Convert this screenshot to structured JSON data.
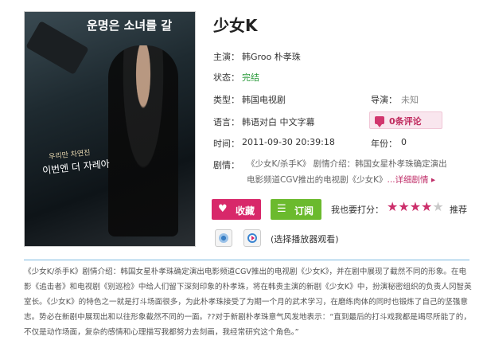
{
  "poster": {
    "banner_text": "운명은 소녀를 갈",
    "subtitle_small": "우리만 차연진",
    "subtitle_large": "이번엔 더 자레아"
  },
  "title": "少女K",
  "fields": {
    "lead_label": "主演：",
    "lead_value": "韩Groo 朴孝珠",
    "status_label": "状态：",
    "status_value": "完结",
    "type_label": "类型：",
    "type_value": "韩国电视剧",
    "director_label": "导演：",
    "director_value": "未知",
    "language_label": "语言：",
    "language_value": "韩语对白 中文字幕",
    "comments_value": "0条评论",
    "time_label": "时间：",
    "time_value": "2011-09-30 20:39:18",
    "year_label": "年份：",
    "year_value": "0",
    "plot_label": "剧情：",
    "plot_value": "《少女K/杀手K》 剧情介绍：韩国女星朴孝珠确定演出电影频道CGV推出的电视剧《少女K》",
    "plot_more": "...详细剧情 ▸"
  },
  "actions": {
    "favorite_label": "收藏",
    "subscribe_label": "订阅",
    "rate_label": "我也要打分：",
    "rating": 4,
    "rating_max": 5,
    "recommend_label": "推荐",
    "select_player_label": "(选择播放器观看)"
  },
  "description": "《少女K/杀手K》剧情介绍：韩国女星朴孝珠确定演出电影频道CGV推出的电视剧《少女K》，并在剧中展现了截然不同的形象。在电影《追击者》和电视剧《别巡检》中给人们留下深刻印象的朴孝珠，将在韩贵主演的新剧《少女K》中，扮演秘密组织的负责人冈智英室长。《少女K》的特色之一就是打斗场面很多，为此朴孝珠接受了为期一个月的武术学习，在磨练肉体的同时也锻炼了自己的坚强意志。势必在新剧中展现出和以往形象截然不同的一面。??对于新剧朴孝珠意气风发地表示：“直到最后的打斗戏我都是竭尽所能了的，不仅是动作场面，复杂的感情和心理描写我都努力去刻画，我经常研究这个角色。”",
  "colors": {
    "accent_pink": "#d8286a",
    "accent_green": "#6bba2e",
    "status_green": "#2a9a3a",
    "divider_blue": "#7ab8e0"
  }
}
